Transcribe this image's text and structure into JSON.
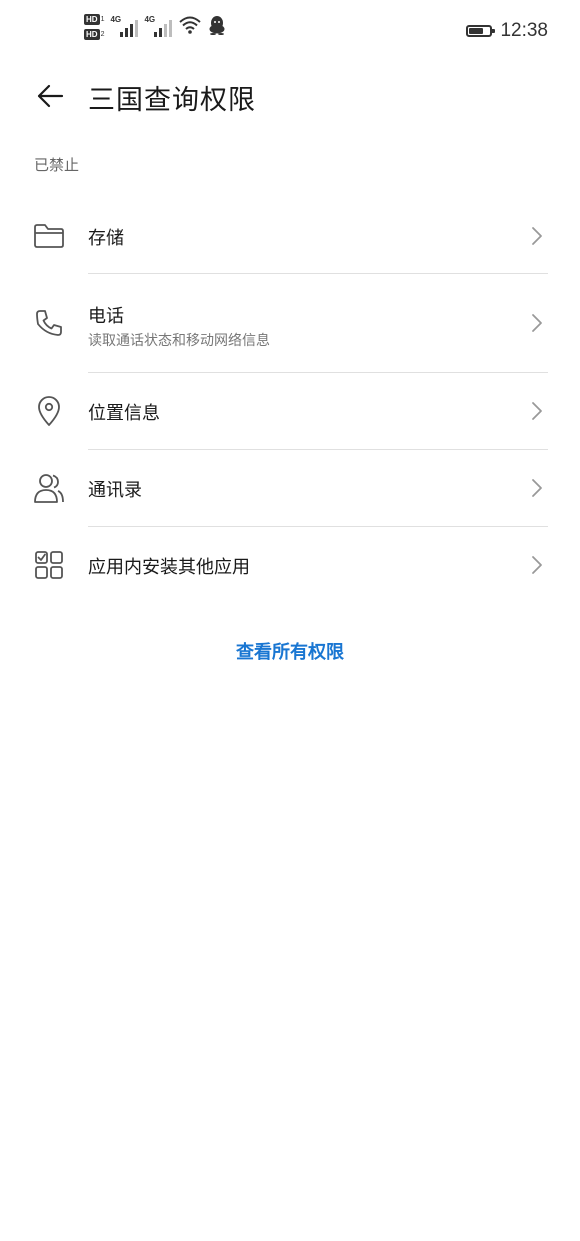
{
  "status_bar": {
    "hd1": "HD",
    "hd1_num": "1",
    "hd2": "HD",
    "hd2_num": "2",
    "signal1_label": "4G",
    "signal2_label": "4G",
    "wifi_icon": "wifi-icon",
    "app_notification_icon": "penguin-icon",
    "battery_level": 0.7,
    "time": "12:38"
  },
  "header": {
    "back_icon": "arrow-left-icon",
    "title": "三国查询权限"
  },
  "section_label": "已禁止",
  "permissions": [
    {
      "icon": "folder-icon",
      "label": "存储",
      "sub": ""
    },
    {
      "icon": "phone-icon",
      "label": "电话",
      "sub": "读取通话状态和移动网络信息"
    },
    {
      "icon": "location-pin-icon",
      "label": "位置信息",
      "sub": ""
    },
    {
      "icon": "contacts-icon",
      "label": "通讯录",
      "sub": ""
    },
    {
      "icon": "app-grid-icon",
      "label": "应用内安装其他应用",
      "sub": ""
    }
  ],
  "view_all_label": "查看所有权限",
  "colors": {
    "accent": "#1976d2",
    "icon": "#555555",
    "divider": "#e0e0e0"
  }
}
